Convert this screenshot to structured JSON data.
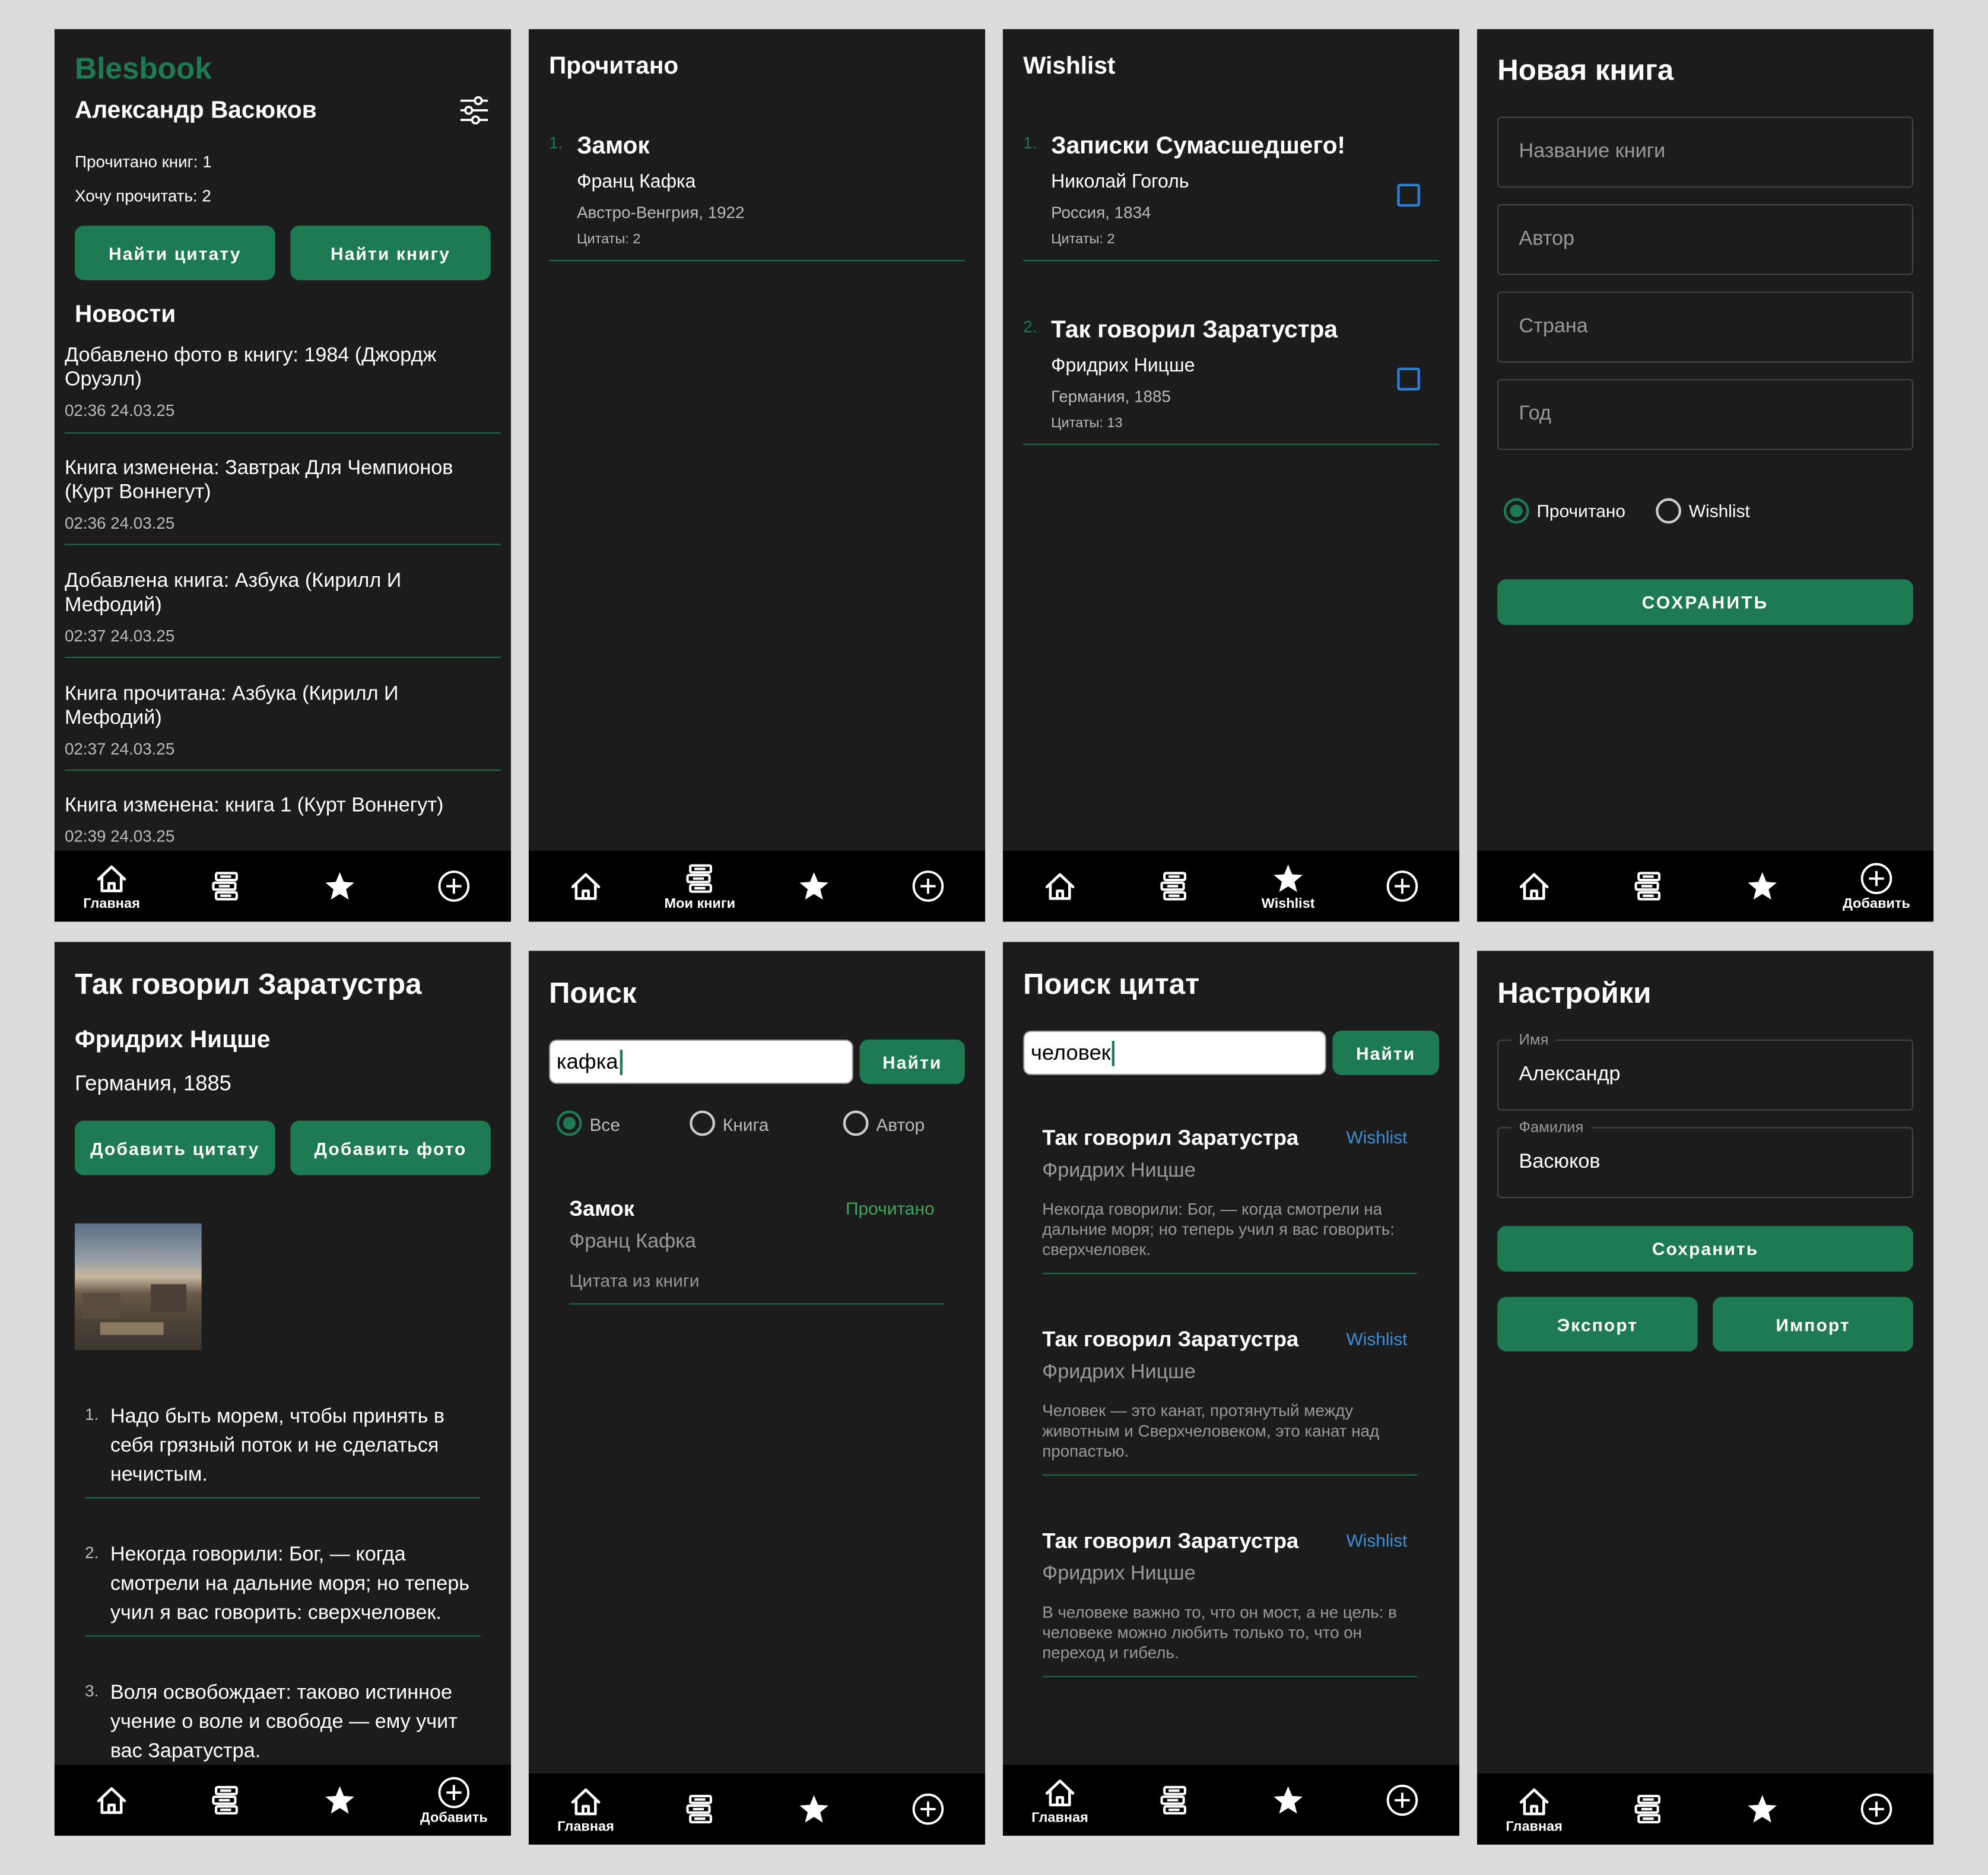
{
  "icons": {
    "home": "home-icon",
    "books": "books-icon",
    "star": "star-icon",
    "add": "plus-circle-icon",
    "settings": "sliders-icon"
  },
  "nav": {
    "home": "Главная",
    "books": "Мои книги",
    "wishlist": "Wishlist",
    "add": "Добавить"
  },
  "home": {
    "app_name": "Blesbook",
    "user_name": "Александр Васюков",
    "read_count": "Прочитано книг: 1",
    "want_count": "Хочу прочитать: 2",
    "find_quote": "Найти цитату",
    "find_book": "Найти книгу",
    "news_title": "Новости",
    "news": [
      {
        "text": "Добавлено фото в книгу: 1984 (Джордж Оруэлл)",
        "time": "02:36 24.03.25"
      },
      {
        "text": "Книга изменена: Завтрак Для Чемпионов (Курт Воннегут)",
        "time": "02:36 24.03.25"
      },
      {
        "text": "Добавлена книга: Азбука (Кирилл И Мефодий)",
        "time": "02:37 24.03.25"
      },
      {
        "text": "Книга прочитана: Азбука (Кирилл И Мефодий)",
        "time": "02:37 24.03.25"
      },
      {
        "text": "Книга изменена: книга 1 (Курт Воннегут)",
        "time": "02:39 24.03.25"
      }
    ]
  },
  "read": {
    "title": "Прочитано",
    "books": [
      {
        "num": "1.",
        "title": "Замок",
        "author": "Франц Кафка",
        "meta": "Австро-Венгрия, 1922",
        "quotes": "Цитаты: 2"
      }
    ]
  },
  "wishlist": {
    "title": "Wishlist",
    "books": [
      {
        "num": "1.",
        "title": "Записки Сумасшедшего!",
        "author": "Николай Гоголь",
        "meta": "Россия, 1834",
        "quotes": "Цитаты: 2"
      },
      {
        "num": "2.",
        "title": "Так говорил Заратустра",
        "author": "Фридрих Ницше",
        "meta": "Германия, 1885",
        "quotes": "Цитаты: 13"
      }
    ]
  },
  "new_book": {
    "title": "Новая книга",
    "fields": [
      "Название книги",
      "Автор",
      "Страна",
      "Год"
    ],
    "radio_read": "Прочитано",
    "radio_wish": "Wishlist",
    "save": "СОХРАНИТЬ"
  },
  "book": {
    "title": "Так говорил Заратустра",
    "author": "Фридрих Ницше",
    "meta": "Германия, 1885",
    "add_quote": "Добавить цитату",
    "add_photo": "Добавить фото",
    "quotes": [
      {
        "num": "1.",
        "text": "Надо быть морем, чтобы принять в себя грязный поток и не сделаться нечистым."
      },
      {
        "num": "2.",
        "text": "Некогда говорили: Бог, — когда смотрели на дальние моря; но теперь учил я вас говорить: сверхчеловек."
      },
      {
        "num": "3.",
        "text": "Воля освобождает: таково истинное учение о воле и свободе — ему учит вас Заратустра."
      }
    ]
  },
  "search": {
    "title": "Поиск",
    "query": "кафка",
    "button": "Найти",
    "radio_all": "Все",
    "radio_book": "Книга",
    "radio_author": "Автор",
    "result": {
      "title": "Замок",
      "author": "Франц Кафка",
      "status": "Прочитано",
      "note": "Цитата из книги"
    }
  },
  "quote_search": {
    "title": "Поиск цитат",
    "query": "человек",
    "button": "Найти",
    "results": [
      {
        "title": "Так говорил Заратустра",
        "author": "Фридрих Ницше",
        "status": "Wishlist",
        "text": "Некогда говорили: Бог, — когда смотрели на дальние моря; но теперь учил я вас говорить: сверхчеловек."
      },
      {
        "title": "Так говорил Заратустра",
        "author": "Фридрих Ницше",
        "status": "Wishlist",
        "text": "Человек — это канат, протянутый между животным и Сверхчеловеком, это канат над пропастью."
      },
      {
        "title": "Так говорил Заратустра",
        "author": "Фридрих Ницше",
        "status": "Wishlist",
        "text": "В человеке важно то, что он мост, а не цель: в человеке можно любить только то, что он переход и гибель."
      }
    ]
  },
  "settings": {
    "title": "Настройки",
    "first_label": "Имя",
    "first_value": "Александр",
    "last_label": "Фамилия",
    "last_value": "Васюков",
    "save": "Сохранить",
    "export": "Экспорт",
    "import": "Импорт"
  },
  "colors": {
    "accent": "#1d7a52",
    "background": "#1c1c1c",
    "navbar": "#000000",
    "wishlist_link": "#3b8fd8",
    "read_status": "#3fa65a"
  }
}
